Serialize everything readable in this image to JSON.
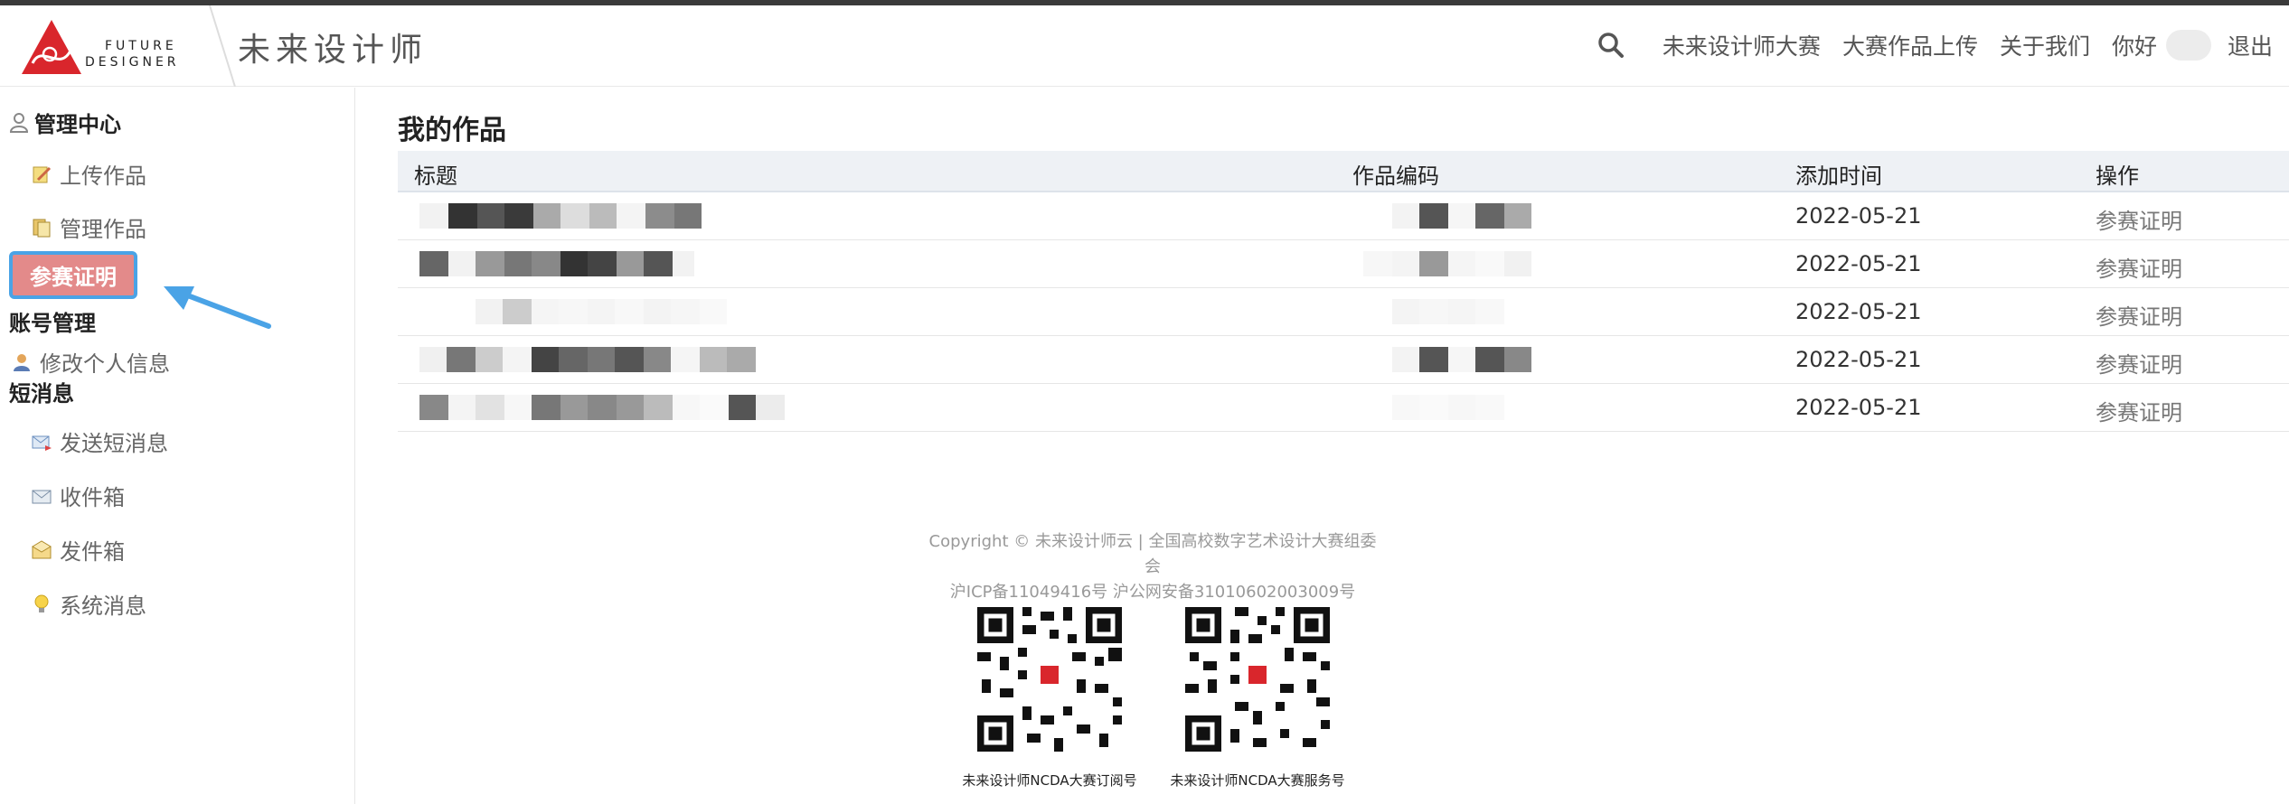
{
  "header": {
    "logo_text_line1": "FUTURE",
    "logo_text_line2": "DESIGNER",
    "site_title": "未来设计师",
    "nav": {
      "competition": "未来设计师大赛",
      "upload": "大赛作品上传",
      "about": "关于我们",
      "greeting": "你好",
      "logout": "退出"
    }
  },
  "sidebar": {
    "admin_center": "管理中心",
    "upload_work": "上传作品",
    "manage_work": "管理作品",
    "certificate": "参赛证明",
    "account_manage": "账号管理",
    "edit_profile": "修改个人信息",
    "messages": "短消息",
    "send_message": "发送短消息",
    "inbox": "收件箱",
    "outbox": "发件箱",
    "system_message": "系统消息"
  },
  "main": {
    "title": "我的作品",
    "columns": [
      "标题",
      "作品编码",
      "添加时间",
      "操作"
    ],
    "rows": [
      {
        "date": "2022-05-21",
        "action": "参赛证明"
      },
      {
        "date": "2022-05-21",
        "action": "参赛证明"
      },
      {
        "date": "2022-05-21",
        "action": "参赛证明"
      },
      {
        "date": "2022-05-21",
        "action": "参赛证明"
      },
      {
        "date": "2022-05-21",
        "action": "参赛证明"
      }
    ]
  },
  "footer": {
    "copyright": "Copyright © 未来设计师云 | 全国高校数字艺术设计大赛组委会",
    "icp": "沪ICP备11049416号 沪公网安备31010602003009号",
    "qr1_caption": "未来设计师NCDA大赛订阅号",
    "qr2_caption": "未来设计师NCDA大赛服务号"
  },
  "colors": {
    "accent_pink": "#e38a8a",
    "highlight_blue": "#4aa3e6",
    "logo_red": "#d9262c"
  }
}
